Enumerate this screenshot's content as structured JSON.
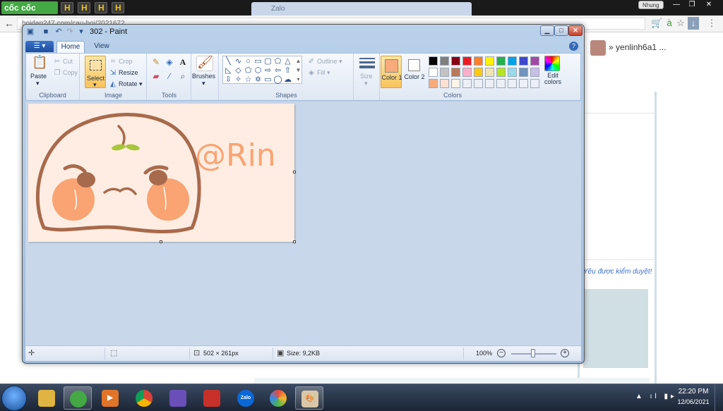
{
  "browser": {
    "brand": "cốc cốc",
    "active_tab_label": "Zalo",
    "profile": "Nhung",
    "url": "hoidap247.com/cau-hoi/2021672",
    "window_controls": [
      "—",
      "❐",
      "✕"
    ]
  },
  "page": {
    "username": "yenlinh6a1 ...",
    "notice": "Yêu được kiểm duyệt!"
  },
  "paint": {
    "title": "302 - Paint",
    "tabs": {
      "home": "Home",
      "view": "View"
    },
    "clipboard": {
      "paste": "Paste",
      "cut": "Cut",
      "copy": "Copy",
      "label": "Clipboard"
    },
    "image": {
      "select": "Select",
      "crop": "Crop",
      "resize": "Resize",
      "rotate": "Rotate",
      "label": "Image"
    },
    "tools": {
      "label": "Tools"
    },
    "brushes": "Brushes",
    "shapes": {
      "label": "Shapes",
      "outline": "Outline",
      "fill": "Fill"
    },
    "size": "Size",
    "colors": {
      "color1": "Color 1",
      "color2": "Color 2",
      "edit": "Edit colors",
      "label": "Colors",
      "color1_value": "#f7ab7b",
      "color2_value": "#ffffff",
      "palette": [
        "#000000",
        "#7f7f7f",
        "#880015",
        "#ed1c24",
        "#ff7f27",
        "#fff200",
        "#22b14c",
        "#00a2e8",
        "#3f48cc",
        "#a349a4",
        "#ffffff",
        "#c3c3c3",
        "#b97a57",
        "#ffaec9",
        "#ffc90e",
        "#efe4b0",
        "#b5e61d",
        "#99d9ea",
        "#7092be",
        "#c8bfe7",
        "#f7ab7b",
        "#ffe0d0",
        "#fff3ea",
        "#ecf0f6",
        "#ecf0f6",
        "#ecf0f6",
        "#ecf0f6",
        "#ecf0f6",
        "#ecf0f6",
        "#ecf0f6"
      ]
    },
    "canvas": {
      "signature": "@Rin",
      "bg_color": "#ffede3",
      "outline_color": "#a86a4c",
      "cheek_color": "#f9a472",
      "leaf_color": "#a8c63a"
    },
    "status": {
      "dimensions": "502 × 261px",
      "size": "Size: 9,2KB",
      "zoom": "100%"
    }
  },
  "taskbar": {
    "zalo": "Zalo",
    "time": "22:20 PM",
    "date": "12/06/2021"
  }
}
